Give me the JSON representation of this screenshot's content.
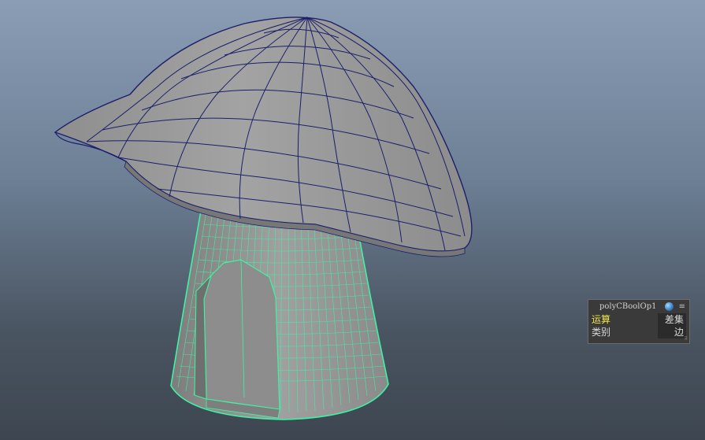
{
  "hud": {
    "title": "polyCBoolOp1",
    "rows": [
      {
        "label": "运算",
        "value": "差集"
      },
      {
        "label": "类别",
        "value": "边"
      }
    ]
  },
  "icons": {
    "node_icon": "sphere-icon",
    "menu_icon": "hamburger-menu-icon",
    "grip_icon": "resize-grip-icon"
  },
  "colors": {
    "cap_wire": "#1a1f6a",
    "stem_wire": "#3cf5a4",
    "mesh_fill": "#9c9c9c",
    "active_label": "#f0e74a"
  }
}
